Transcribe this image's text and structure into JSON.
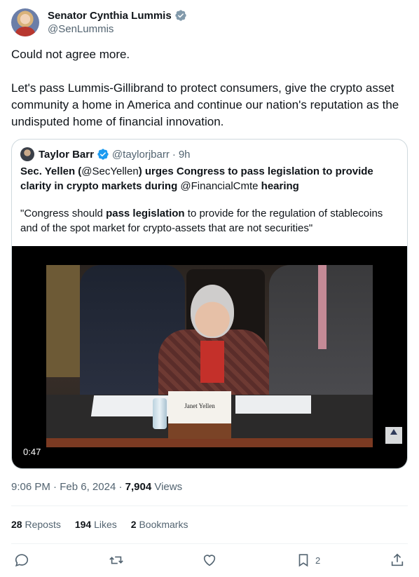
{
  "author": {
    "name": "Senator Cynthia Lummis",
    "handle": "@SenLummis"
  },
  "tweet": {
    "paragraph1": "Could not agree more.",
    "paragraph2": "Let's pass Lummis-Gillibrand to protect consumers, give the crypto asset community a home in America and continue our nation's reputation as the undisputed home of financial innovation."
  },
  "quote": {
    "author_name": "Taylor Barr",
    "author_handle": "@taylorjbarr",
    "separator": "·",
    "time": "9h",
    "title_part1": "Sec. Yellen (",
    "title_mention1": "@SecYellen",
    "title_part2": ") urges Congress to pass legislation to provide clarity in crypto markets during ",
    "title_mention2": "@FinancialCmte",
    "title_part3": " hearing",
    "body_part1": "\"Congress should ",
    "body_bold": "pass legislation",
    "body_part2": " to provide for the regulation of stablecoins and of the spot market for crypto-assets that are not securities\"",
    "video_duration": "0:47",
    "nameplate_text": "Janet Yellen"
  },
  "meta": {
    "time": "9:06 PM",
    "dot": "·",
    "date": "Feb 6, 2024",
    "views_count": "7,904",
    "views_label": "Views"
  },
  "stats": {
    "reposts_count": "28",
    "reposts_label": "Reposts",
    "likes_count": "194",
    "likes_label": "Likes",
    "bookmarks_count": "2",
    "bookmarks_label": "Bookmarks"
  },
  "actions": {
    "bookmark_count": "2"
  },
  "colors": {
    "text_primary": "#0f1419",
    "text_secondary": "#536471",
    "verified_blue": "#1d9bf0",
    "verified_gray": "#829aab",
    "border": "#cfd9de"
  },
  "icons": [
    "verified-gray-icon",
    "verified-blue-icon",
    "reply-icon",
    "repost-icon",
    "like-icon",
    "bookmark-icon",
    "share-icon"
  ]
}
